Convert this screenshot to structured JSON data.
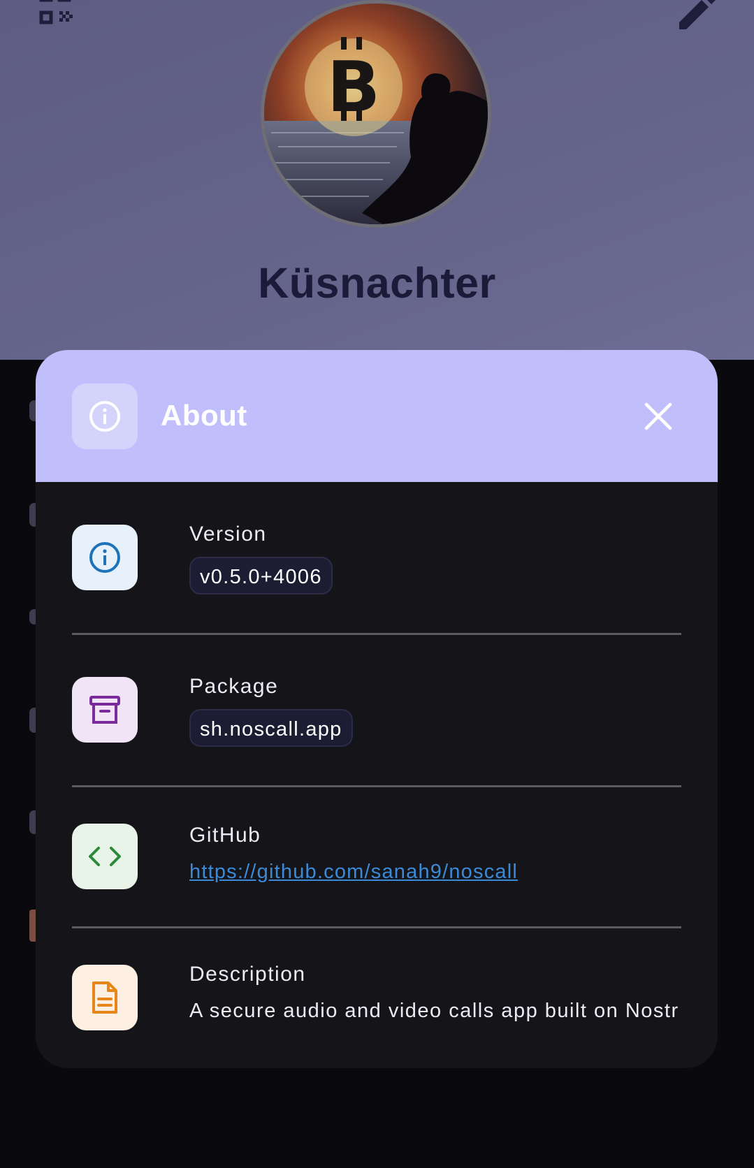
{
  "profile": {
    "name": "Küsnachter"
  },
  "dialog": {
    "title": "About",
    "rows": [
      {
        "label": "Version",
        "value": "v0.5.0+4006",
        "icon": "info-icon",
        "icon_color": "#1e73b8",
        "icon_bg": "#e6f1fb"
      },
      {
        "label": "Package",
        "value": "sh.noscall.app",
        "icon": "archive-icon",
        "icon_color": "#7b2a9c",
        "icon_bg": "#f2e4f7"
      },
      {
        "label": "GitHub",
        "value": "https://github.com/sanah9/noscall",
        "icon": "code-icon",
        "icon_color": "#2e8a3a",
        "icon_bg": "#e7f4e7"
      },
      {
        "label": "Description",
        "value": "A secure audio and video calls app built on Nostr",
        "icon": "document-icon",
        "icon_color": "#e8861a",
        "icon_bg": "#fdefe1"
      }
    ]
  },
  "colors": {
    "dialog_header_bg": "#c1bffb",
    "dialog_bg": "#151519",
    "link": "#3b8ad8"
  }
}
